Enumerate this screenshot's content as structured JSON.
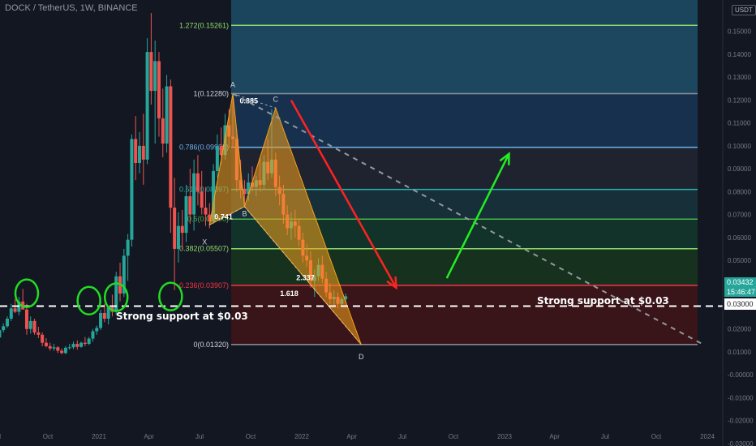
{
  "header": {
    "title": "DOCK / TetherUS, 1W, BINANCE",
    "currency": "USDT"
  },
  "price_tag": {
    "price": "0.03432",
    "countdown": "15:46:47"
  },
  "support_tag": "0.03000",
  "annotations": {
    "support_left": "Strong support at $0.03",
    "support_right": "Strong support at $0.03"
  },
  "colors": {
    "up": "#26a69a",
    "down": "#ef5350",
    "support_circle": "#22dd22",
    "bull_arrow": "#22ee22",
    "bear_arrow": "#ff2222",
    "pattern": "#f7a21b"
  },
  "chart_data": {
    "type": "candlestick",
    "symbol": "DOCK/USDT",
    "timeframe": "1W",
    "y_axis": {
      "scale": "linear",
      "ticks": [
        "0.15000",
        "0.14000",
        "0.13000",
        "0.12000",
        "0.11000",
        "0.10000",
        "0.09000",
        "0.08000",
        "0.07000",
        "0.06000",
        "0.05000",
        "0.04000",
        "0.03000",
        "0.02000",
        "0.01000",
        "-0.00000",
        "-0.01000",
        "-0.02000",
        "-0.03000"
      ],
      "tick_values": [
        0.15,
        0.14,
        0.13,
        0.12,
        0.11,
        0.1,
        0.09,
        0.08,
        0.07,
        0.06,
        0.05,
        0.04,
        0.03,
        0.02,
        0.01,
        0,
        -0.01,
        -0.02,
        -0.03
      ],
      "range": [
        -0.0311,
        0.1637
      ]
    },
    "x_axis": {
      "ticks": [
        "Jul",
        "Oct",
        "2021",
        "Apr",
        "Jul",
        "Oct",
        "2022",
        "Apr",
        "Jul",
        "Oct",
        "2023",
        "Apr",
        "Jul",
        "Oct",
        "2024"
      ],
      "tick_dates": [
        "2020-07-01",
        "2020-10-01",
        "2021-01-01",
        "2021-04-01",
        "2021-07-01",
        "2021-10-01",
        "2022-01-01",
        "2022-04-01",
        "2022-07-01",
        "2022-10-01",
        "2023-01-01",
        "2023-04-01",
        "2023-07-01",
        "2023-10-01",
        "2024-01-01"
      ]
    },
    "fib_levels": [
      {
        "label": "1.272(0.15261)",
        "ratio": 1.272,
        "price": 0.15261,
        "line_color": "#8fdc6b",
        "label_color": "#8fdc6b",
        "zone_color": "#1d4a63"
      },
      {
        "label": "1(0.12280)",
        "ratio": 1.0,
        "price": 0.1228,
        "line_color": "#8f939c",
        "label_color": "#d1d4dc",
        "zone_color": "#173150"
      },
      {
        "label": "0.786(0.09935)",
        "ratio": 0.786,
        "price": 0.09935,
        "line_color": "#6fb3ea",
        "label_color": "#6fb3ea",
        "zone_color": "#202430"
      },
      {
        "label": "0.618(0.08097)",
        "ratio": 0.618,
        "price": 0.08097,
        "line_color": "#27b3a7",
        "label_color": "#27b3a7",
        "zone_color": "#17303a"
      },
      {
        "label": "0.5(0.06800)",
        "ratio": 0.5,
        "price": 0.068,
        "line_color": "#49b34a",
        "label_color": "#49b34a",
        "zone_color": "#12352a"
      },
      {
        "label": "0.382(0.05507)",
        "ratio": 0.382,
        "price": 0.05507,
        "line_color": "#8fdc6b",
        "label_color": "#8fdc6b",
        "zone_color": "#16331f"
      },
      {
        "label": "0.236(0.03907)",
        "ratio": 0.236,
        "price": 0.03907,
        "line_color": "#f23645",
        "label_color": "#f23645",
        "zone_color": "#232a1c"
      },
      {
        "label": "0(0.01320)",
        "ratio": 0,
        "price": 0.0132,
        "line_color": "#8f939c",
        "label_color": "#d1d4dc",
        "zone_color": "#3b1418"
      }
    ],
    "harmonic_pattern": {
      "points": [
        {
          "label": "X",
          "date": "2021-07-19",
          "price": 0.0655
        },
        {
          "label": "A",
          "date": "2021-08-30",
          "price": 0.1228
        },
        {
          "label": "B",
          "date": "2021-09-20",
          "price": 0.0735
        },
        {
          "label": "C",
          "date": "2021-11-15",
          "price": 0.1165
        },
        {
          "label": "D",
          "date": "2022-04-18",
          "price": 0.0132
        }
      ],
      "ratios": [
        {
          "label": "0.885",
          "value": 0.885
        },
        {
          "label": "0.741",
          "value": 0.741
        },
        {
          "label": "2.337",
          "value": 2.337
        },
        {
          "label": "1.618",
          "value": 1.618
        }
      ]
    },
    "horizontal_support": {
      "price": 0.03,
      "label": "Strong support at $0.03"
    },
    "trendline": {
      "from": {
        "date": "2021-08-30",
        "price": 0.1228
      },
      "to": {
        "date": "2023-12-25",
        "price": 0.0132
      }
    },
    "arrows": [
      {
        "direction": "down",
        "from": {
          "date": "2021-12-13",
          "price": 0.1199
        },
        "to": {
          "date": "2022-06-20",
          "price": 0.038
        }
      },
      {
        "direction": "up",
        "from": {
          "date": "2022-09-19",
          "price": 0.0422
        },
        "to": {
          "date": "2023-01-09",
          "price": 0.0965
        }
      }
    ],
    "support_circles": [
      {
        "date": "2020-08-24",
        "price": 0.0356
      },
      {
        "date": "2020-12-14",
        "price": 0.0324
      },
      {
        "date": "2021-02-01",
        "price": 0.0339
      },
      {
        "date": "2021-05-10",
        "price": 0.0342
      }
    ],
    "candles": [
      {
        "date": "2020-06-29",
        "o": 0.017,
        "h": 0.019,
        "l": 0.0155,
        "c": 0.0163
      },
      {
        "date": "2020-07-06",
        "o": 0.0163,
        "h": 0.0205,
        "l": 0.0158,
        "c": 0.0195
      },
      {
        "date": "2020-07-13",
        "o": 0.0195,
        "h": 0.0225,
        "l": 0.0185,
        "c": 0.0212
      },
      {
        "date": "2020-07-20",
        "o": 0.0212,
        "h": 0.0255,
        "l": 0.0205,
        "c": 0.0245
      },
      {
        "date": "2020-07-27",
        "o": 0.0245,
        "h": 0.031,
        "l": 0.0235,
        "c": 0.029
      },
      {
        "date": "2020-08-03",
        "o": 0.029,
        "h": 0.033,
        "l": 0.027,
        "c": 0.0275
      },
      {
        "date": "2020-08-10",
        "o": 0.0275,
        "h": 0.034,
        "l": 0.026,
        "c": 0.032
      },
      {
        "date": "2020-08-17",
        "o": 0.032,
        "h": 0.0375,
        "l": 0.029,
        "c": 0.0285
      },
      {
        "date": "2020-08-24",
        "o": 0.0285,
        "h": 0.031,
        "l": 0.0175,
        "c": 0.02
      },
      {
        "date": "2020-08-31",
        "o": 0.02,
        "h": 0.0255,
        "l": 0.018,
        "c": 0.0235
      },
      {
        "date": "2020-09-07",
        "o": 0.0235,
        "h": 0.0245,
        "l": 0.0175,
        "c": 0.0185
      },
      {
        "date": "2020-09-14",
        "o": 0.0185,
        "h": 0.021,
        "l": 0.016,
        "c": 0.0175
      },
      {
        "date": "2020-09-21",
        "o": 0.0175,
        "h": 0.0185,
        "l": 0.0125,
        "c": 0.014
      },
      {
        "date": "2020-09-28",
        "o": 0.014,
        "h": 0.016,
        "l": 0.012,
        "c": 0.0125
      },
      {
        "date": "2020-10-05",
        "o": 0.0125,
        "h": 0.014,
        "l": 0.0105,
        "c": 0.0115
      },
      {
        "date": "2020-10-12",
        "o": 0.0115,
        "h": 0.0135,
        "l": 0.0105,
        "c": 0.012
      },
      {
        "date": "2020-10-19",
        "o": 0.012,
        "h": 0.0125,
        "l": 0.0095,
        "c": 0.0105
      },
      {
        "date": "2020-10-26",
        "o": 0.0105,
        "h": 0.0115,
        "l": 0.009,
        "c": 0.0095
      },
      {
        "date": "2020-11-02",
        "o": 0.0095,
        "h": 0.0125,
        "l": 0.009,
        "c": 0.0118
      },
      {
        "date": "2020-11-09",
        "o": 0.0118,
        "h": 0.0135,
        "l": 0.011,
        "c": 0.012
      },
      {
        "date": "2020-11-16",
        "o": 0.012,
        "h": 0.0145,
        "l": 0.0112,
        "c": 0.0135
      },
      {
        "date": "2020-11-23",
        "o": 0.0135,
        "h": 0.015,
        "l": 0.011,
        "c": 0.0122
      },
      {
        "date": "2020-11-30",
        "o": 0.0122,
        "h": 0.0145,
        "l": 0.0118,
        "c": 0.014
      },
      {
        "date": "2020-12-07",
        "o": 0.014,
        "h": 0.0165,
        "l": 0.0125,
        "c": 0.0135
      },
      {
        "date": "2020-12-14",
        "o": 0.0135,
        "h": 0.0165,
        "l": 0.013,
        "c": 0.0158
      },
      {
        "date": "2020-12-21",
        "o": 0.0158,
        "h": 0.02,
        "l": 0.0145,
        "c": 0.019
      },
      {
        "date": "2020-12-28",
        "o": 0.019,
        "h": 0.0215,
        "l": 0.0175,
        "c": 0.0205
      },
      {
        "date": "2021-01-04",
        "o": 0.0205,
        "h": 0.0285,
        "l": 0.0195,
        "c": 0.027
      },
      {
        "date": "2021-01-11",
        "o": 0.027,
        "h": 0.031,
        "l": 0.023,
        "c": 0.0245
      },
      {
        "date": "2021-01-18",
        "o": 0.0245,
        "h": 0.03,
        "l": 0.022,
        "c": 0.0295
      },
      {
        "date": "2021-01-25",
        "o": 0.0295,
        "h": 0.035,
        "l": 0.0255,
        "c": 0.0275
      },
      {
        "date": "2021-02-01",
        "o": 0.0275,
        "h": 0.045,
        "l": 0.026,
        "c": 0.043
      },
      {
        "date": "2021-02-08",
        "o": 0.043,
        "h": 0.049,
        "l": 0.032,
        "c": 0.0355
      },
      {
        "date": "2021-02-15",
        "o": 0.0355,
        "h": 0.055,
        "l": 0.034,
        "c": 0.052
      },
      {
        "date": "2021-02-22",
        "o": 0.052,
        "h": 0.0615,
        "l": 0.041,
        "c": 0.059
      },
      {
        "date": "2021-03-01",
        "o": 0.059,
        "h": 0.105,
        "l": 0.056,
        "c": 0.103
      },
      {
        "date": "2021-03-08",
        "o": 0.103,
        "h": 0.113,
        "l": 0.085,
        "c": 0.0925
      },
      {
        "date": "2021-03-15",
        "o": 0.0925,
        "h": 0.106,
        "l": 0.088,
        "c": 0.1
      },
      {
        "date": "2021-03-22",
        "o": 0.1,
        "h": 0.114,
        "l": 0.083,
        "c": 0.094
      },
      {
        "date": "2021-03-29",
        "o": 0.094,
        "h": 0.147,
        "l": 0.092,
        "c": 0.141
      },
      {
        "date": "2021-04-05",
        "o": 0.141,
        "h": 0.158,
        "l": 0.118,
        "c": 0.124
      },
      {
        "date": "2021-04-12",
        "o": 0.124,
        "h": 0.146,
        "l": 0.101,
        "c": 0.137
      },
      {
        "date": "2021-04-19",
        "o": 0.137,
        "h": 0.141,
        "l": 0.104,
        "c": 0.112
      },
      {
        "date": "2021-04-26",
        "o": 0.112,
        "h": 0.125,
        "l": 0.095,
        "c": 0.101
      },
      {
        "date": "2021-05-03",
        "o": 0.101,
        "h": 0.131,
        "l": 0.097,
        "c": 0.126
      },
      {
        "date": "2021-05-10",
        "o": 0.126,
        "h": 0.129,
        "l": 0.062,
        "c": 0.073
      },
      {
        "date": "2021-05-17",
        "o": 0.073,
        "h": 0.086,
        "l": 0.037,
        "c": 0.055
      },
      {
        "date": "2021-05-24",
        "o": 0.055,
        "h": 0.071,
        "l": 0.049,
        "c": 0.065
      },
      {
        "date": "2021-05-31",
        "o": 0.065,
        "h": 0.072,
        "l": 0.055,
        "c": 0.062
      },
      {
        "date": "2021-06-07",
        "o": 0.062,
        "h": 0.083,
        "l": 0.058,
        "c": 0.078
      },
      {
        "date": "2021-06-14",
        "o": 0.078,
        "h": 0.09,
        "l": 0.066,
        "c": 0.07
      },
      {
        "date": "2021-06-21",
        "o": 0.07,
        "h": 0.094,
        "l": 0.063,
        "c": 0.088
      },
      {
        "date": "2021-06-28",
        "o": 0.088,
        "h": 0.096,
        "l": 0.074,
        "c": 0.08
      },
      {
        "date": "2021-07-05",
        "o": 0.08,
        "h": 0.089,
        "l": 0.07,
        "c": 0.073
      },
      {
        "date": "2021-07-12",
        "o": 0.073,
        "h": 0.082,
        "l": 0.065,
        "c": 0.07
      },
      {
        "date": "2021-07-19",
        "o": 0.07,
        "h": 0.075,
        "l": 0.064,
        "c": 0.067
      },
      {
        "date": "2021-07-26",
        "o": 0.067,
        "h": 0.092,
        "l": 0.066,
        "c": 0.089
      },
      {
        "date": "2021-08-02",
        "o": 0.089,
        "h": 0.105,
        "l": 0.086,
        "c": 0.1
      },
      {
        "date": "2021-08-09",
        "o": 0.1,
        "h": 0.108,
        "l": 0.092,
        "c": 0.096
      },
      {
        "date": "2021-08-16",
        "o": 0.096,
        "h": 0.114,
        "l": 0.094,
        "c": 0.109
      },
      {
        "date": "2021-08-23",
        "o": 0.109,
        "h": 0.116,
        "l": 0.099,
        "c": 0.104
      },
      {
        "date": "2021-08-30",
        "o": 0.104,
        "h": 0.123,
        "l": 0.099,
        "c": 0.103
      },
      {
        "date": "2021-09-06",
        "o": 0.103,
        "h": 0.107,
        "l": 0.08,
        "c": 0.085
      },
      {
        "date": "2021-09-13",
        "o": 0.085,
        "h": 0.094,
        "l": 0.077,
        "c": 0.081
      },
      {
        "date": "2021-09-20",
        "o": 0.081,
        "h": 0.085,
        "l": 0.073,
        "c": 0.079
      },
      {
        "date": "2021-09-27",
        "o": 0.079,
        "h": 0.088,
        "l": 0.076,
        "c": 0.084
      },
      {
        "date": "2021-10-04",
        "o": 0.084,
        "h": 0.091,
        "l": 0.08,
        "c": 0.082
      },
      {
        "date": "2021-10-11",
        "o": 0.082,
        "h": 0.087,
        "l": 0.078,
        "c": 0.085
      },
      {
        "date": "2021-10-18",
        "o": 0.085,
        "h": 0.095,
        "l": 0.08,
        "c": 0.083
      },
      {
        "date": "2021-10-25",
        "o": 0.083,
        "h": 0.096,
        "l": 0.081,
        "c": 0.093
      },
      {
        "date": "2021-11-01",
        "o": 0.093,
        "h": 0.103,
        "l": 0.085,
        "c": 0.088
      },
      {
        "date": "2021-11-08",
        "o": 0.088,
        "h": 0.116,
        "l": 0.086,
        "c": 0.094
      },
      {
        "date": "2021-11-15",
        "o": 0.094,
        "h": 0.097,
        "l": 0.078,
        "c": 0.082
      },
      {
        "date": "2021-11-22",
        "o": 0.082,
        "h": 0.087,
        "l": 0.074,
        "c": 0.079
      },
      {
        "date": "2021-11-29",
        "o": 0.079,
        "h": 0.083,
        "l": 0.066,
        "c": 0.07
      },
      {
        "date": "2021-12-06",
        "o": 0.07,
        "h": 0.074,
        "l": 0.061,
        "c": 0.064
      },
      {
        "date": "2021-12-13",
        "o": 0.064,
        "h": 0.071,
        "l": 0.059,
        "c": 0.067
      },
      {
        "date": "2021-12-20",
        "o": 0.067,
        "h": 0.072,
        "l": 0.06,
        "c": 0.065
      },
      {
        "date": "2021-12-27",
        "o": 0.065,
        "h": 0.068,
        "l": 0.056,
        "c": 0.059
      },
      {
        "date": "2022-01-03",
        "o": 0.059,
        "h": 0.062,
        "l": 0.049,
        "c": 0.052
      },
      {
        "date": "2022-01-10",
        "o": 0.052,
        "h": 0.057,
        "l": 0.047,
        "c": 0.05
      },
      {
        "date": "2022-01-17",
        "o": 0.05,
        "h": 0.054,
        "l": 0.038,
        "c": 0.041
      },
      {
        "date": "2022-01-24",
        "o": 0.041,
        "h": 0.046,
        "l": 0.034,
        "c": 0.043
      },
      {
        "date": "2022-01-31",
        "o": 0.043,
        "h": 0.051,
        "l": 0.041,
        "c": 0.048
      },
      {
        "date": "2022-02-07",
        "o": 0.048,
        "h": 0.052,
        "l": 0.04,
        "c": 0.042
      },
      {
        "date": "2022-02-14",
        "o": 0.042,
        "h": 0.045,
        "l": 0.034,
        "c": 0.036
      },
      {
        "date": "2022-02-21",
        "o": 0.036,
        "h": 0.04,
        "l": 0.031,
        "c": 0.033
      },
      {
        "date": "2022-02-28",
        "o": 0.033,
        "h": 0.037,
        "l": 0.03,
        "c": 0.034
      },
      {
        "date": "2022-03-07",
        "o": 0.034,
        "h": 0.036,
        "l": 0.029,
        "c": 0.031
      },
      {
        "date": "2022-03-14",
        "o": 0.031,
        "h": 0.034,
        "l": 0.03,
        "c": 0.033
      },
      {
        "date": "2022-03-21",
        "o": 0.033,
        "h": 0.0355,
        "l": 0.0315,
        "c": 0.0343
      }
    ]
  }
}
